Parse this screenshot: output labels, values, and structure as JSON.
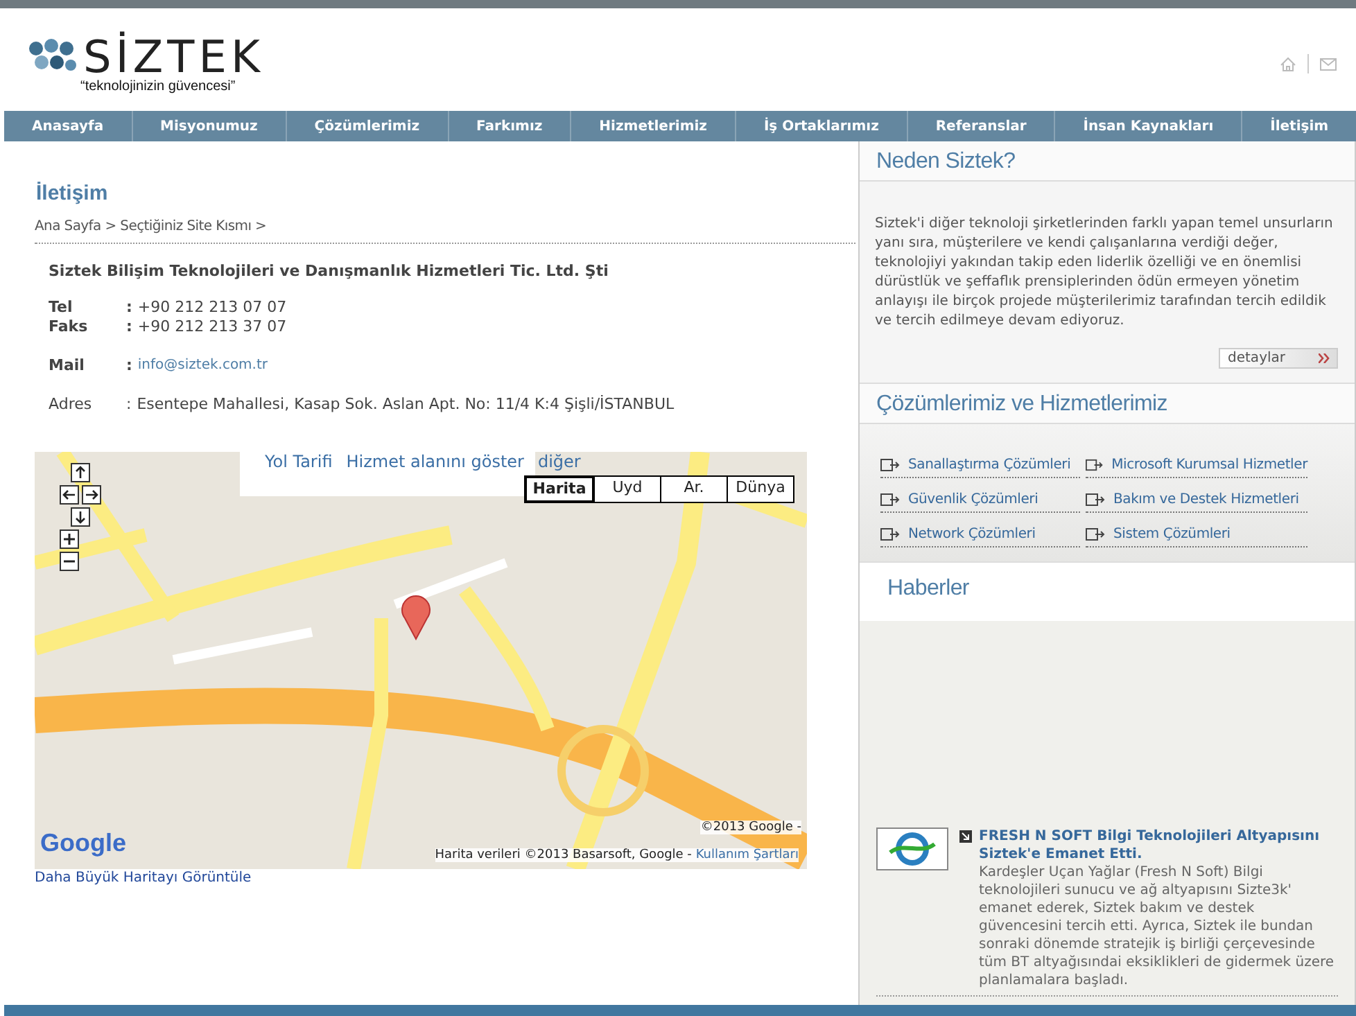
{
  "header": {
    "logo_text": "SİZTEK",
    "tagline": "“teknolojinizin güvencesi”"
  },
  "nav": [
    {
      "label": "Anasayfa"
    },
    {
      "label": "Misyonumuz"
    },
    {
      "label": "Çözümlerimiz"
    },
    {
      "label": "Farkımız"
    },
    {
      "label": "Hizmetlerimiz"
    },
    {
      "label": "İş Ortaklarımız"
    },
    {
      "label": "Referanslar"
    },
    {
      "label": "İnsan Kaynakları"
    },
    {
      "label": "İletişim"
    }
  ],
  "contact": {
    "title": "İletişim",
    "breadcrumb": "Ana Sayfa > Seçtiğiniz Site Kısmı >",
    "company": "Siztek Bilişim Teknolojileri ve Danışmanlık Hizmetleri Tic. Ltd. Şti",
    "groups": [
      [
        {
          "label": "Tel",
          "separator": ":",
          "value": "+90 212 213 07 07",
          "kind": "text",
          "emphasized": true
        },
        {
          "label": "Faks",
          "separator": ":",
          "value": "+90 212 213 37 07",
          "kind": "text",
          "emphasized": true
        }
      ],
      [
        {
          "label": "Mail",
          "separator": ":",
          "value": "info@siztek.com.tr",
          "kind": "link",
          "emphasized": true
        }
      ],
      [
        {
          "label": "Adres",
          "separator": ":",
          "value": "Esentepe Mahallesi, Kasap Sok. Aslan Apt. No: 11/4 K:4 Şişli/İSTANBUL",
          "kind": "text",
          "emphasized": false
        }
      ]
    ]
  },
  "map": {
    "links": [
      "Yol Tarifi",
      "Hizmet alanını göster"
    ],
    "more": "diğer",
    "types": [
      {
        "label": "Harita",
        "selected": true
      },
      {
        "label": "Uyd",
        "selected": false
      },
      {
        "label": "Ar.",
        "selected": false
      },
      {
        "label": "Dünya",
        "selected": false
      }
    ],
    "logo": "Google",
    "copyright": "©2013 Google -",
    "attribution": "Harita verileri ©2013 Basarsoft, Google -",
    "terms": "Kullanım Şartları",
    "larger_map_link": "Daha Büyük Haritayı Görüntüle"
  },
  "why": {
    "title": "Neden Siztek?",
    "text": "Siztek'i diğer teknoloji şirketlerinden farklı yapan temel unsurların yanı sıra, müşterilere ve kendi çalışanlarına verdiği değer, teknolojiyi yakından takip eden liderlik özelliği ve en önemlisi dürüstlük ve şeffaflık prensiplerinden ödün ermeyen yönetim anlayışı ile birçok projede müşterilerimiz tarafından tercih edildik ve tercih edilmeye devam ediyoruz.",
    "button": "detaylar"
  },
  "solutions": {
    "title": "Çözümlerimiz ve Hizmetlerimiz",
    "items": [
      "Sanallaştırma Çözümleri",
      "Microsoft Kurumsal Hizmetler",
      "Güvenlik Çözümleri",
      "Bakım ve Destek Hizmetleri",
      "Network Çözümleri",
      "Sistem Çözümleri"
    ]
  },
  "news": {
    "title": "Haberler",
    "items": [
      {
        "headline": "FRESH N SOFT Bilgi Teknolojileri Altyapısını Siztek'e Emanet Etti.",
        "body": "Kardeşler Uçan Yağlar (Fresh N Soft) Bilgi teknolojileri sunucu ve ağ altyapısını Sizte3k' emanet ederek, Siztek bakım ve destek güvencesini tercih etti. Ayrıca, Siztek ile bundan sonraki dönemde stratejik iş birliği çerçevesinde tüm BT altyağısındai eksiklikleri de gidermek üzere planlamalara başladı."
      }
    ]
  }
}
